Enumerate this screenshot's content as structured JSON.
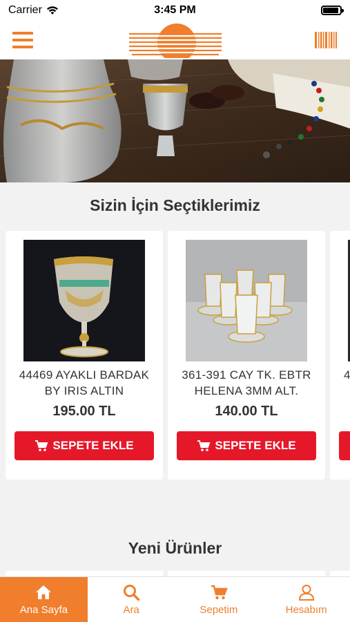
{
  "status_bar": {
    "carrier": "Carrier",
    "time": "3:45 PM",
    "battery_level": 0.92
  },
  "header": {
    "menu_icon": "hamburger-icon",
    "barcode_icon": "barcode-icon"
  },
  "featured": {
    "title": "Sizin İçin Seçtiklerimiz",
    "products": [
      {
        "name": "44469 AYAKLI BARDAK BY IRIS ALTIN",
        "price": "195.00 TL",
        "button": "SEPETE EKLE"
      },
      {
        "name": "361-391 CAY TK. EBTR HELENA 3MM ALT.",
        "price": "140.00 TL",
        "button": "SEPETE EKLE"
      }
    ],
    "peek_text": "4"
  },
  "new_products": {
    "title": "Yeni Ürünler"
  },
  "tabs": [
    {
      "label": "Ana Sayfa",
      "icon": "home-icon",
      "active": true
    },
    {
      "label": "Ara",
      "icon": "search-icon",
      "active": false
    },
    {
      "label": "Sepetim",
      "icon": "cart-icon",
      "active": false
    },
    {
      "label": "Hesabım",
      "icon": "user-icon",
      "active": false
    }
  ],
  "colors": {
    "accent": "#f07e2c",
    "button_red": "#e5182a"
  }
}
